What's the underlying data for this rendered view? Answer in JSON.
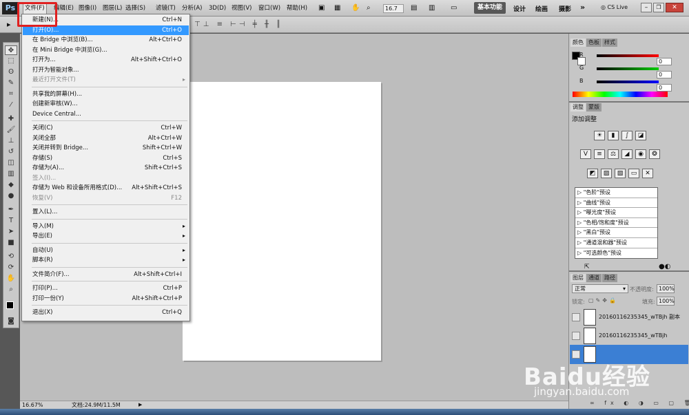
{
  "app": {
    "logo": "Ps"
  },
  "menubar": {
    "items": [
      "文件(F)",
      "编辑(E)",
      "图像(I)",
      "图层(L)",
      "选择(S)",
      "滤镜(T)",
      "分析(A)",
      "3D(D)",
      "视图(V)",
      "窗口(W)",
      "帮助(H)"
    ],
    "zoom": "16.7",
    "workspaces": [
      "基本功能",
      "设计",
      "绘画",
      "摄影"
    ],
    "more": "»",
    "cslive": "CS Live"
  },
  "file_menu": [
    {
      "label": "新建(N)...",
      "shortcut": "Ctrl+N"
    },
    {
      "label": "打开(O)...",
      "shortcut": "Ctrl+O",
      "highlighted": true
    },
    {
      "label": "在 Bridge 中浏览(B)...",
      "shortcut": "Alt+Ctrl+O"
    },
    {
      "label": "在 Mini Bridge 中浏览(G)...",
      "shortcut": ""
    },
    {
      "label": "打开为...",
      "shortcut": "Alt+Shift+Ctrl+O"
    },
    {
      "label": "打开为智能对象...",
      "shortcut": ""
    },
    {
      "label": "最近打开文件(T)",
      "shortcut": "",
      "submenu": true,
      "disabled": true
    },
    {
      "sep": true
    },
    {
      "label": "共享我的屏幕(H)...",
      "shortcut": ""
    },
    {
      "label": "创建新审核(W)...",
      "shortcut": ""
    },
    {
      "label": "Device Central...",
      "shortcut": ""
    },
    {
      "sep": true
    },
    {
      "label": "关闭(C)",
      "shortcut": "Ctrl+W"
    },
    {
      "label": "关闭全部",
      "shortcut": "Alt+Ctrl+W"
    },
    {
      "label": "关闭并转到 Bridge...",
      "shortcut": "Shift+Ctrl+W"
    },
    {
      "label": "存储(S)",
      "shortcut": "Ctrl+S"
    },
    {
      "label": "存储为(A)...",
      "shortcut": "Shift+Ctrl+S"
    },
    {
      "label": "签入(I)...",
      "shortcut": "",
      "disabled": true
    },
    {
      "label": "存储为 Web 和设备所用格式(D)...",
      "shortcut": "Alt+Shift+Ctrl+S"
    },
    {
      "label": "恢复(V)",
      "shortcut": "F12",
      "disabled": true
    },
    {
      "sep": true
    },
    {
      "label": "置入(L)...",
      "shortcut": ""
    },
    {
      "sep": true
    },
    {
      "label": "导入(M)",
      "shortcut": "",
      "submenu": true
    },
    {
      "label": "导出(E)",
      "shortcut": "",
      "submenu": true
    },
    {
      "sep": true
    },
    {
      "label": "自动(U)",
      "shortcut": "",
      "submenu": true
    },
    {
      "label": "脚本(R)",
      "shortcut": "",
      "submenu": true
    },
    {
      "sep": true
    },
    {
      "label": "文件简介(F)...",
      "shortcut": "Alt+Shift+Ctrl+I"
    },
    {
      "sep": true
    },
    {
      "label": "打印(P)...",
      "shortcut": "Ctrl+P"
    },
    {
      "label": "打印一份(Y)",
      "shortcut": "Alt+Shift+Ctrl+P"
    },
    {
      "sep": true
    },
    {
      "label": "退出(X)",
      "shortcut": "Ctrl+Q"
    }
  ],
  "color_panel": {
    "tabs": [
      "颜色",
      "色板",
      "样式"
    ],
    "channels": [
      {
        "name": "R",
        "value": "0"
      },
      {
        "name": "G",
        "value": "0"
      },
      {
        "name": "B",
        "value": "0"
      }
    ]
  },
  "adjustments_panel": {
    "tabs": [
      "调整",
      "蒙版"
    ],
    "title": "添加调整",
    "presets": [
      "\"色阶\"预设",
      "\"曲线\"预设",
      "\"曝光度\"预设",
      "\"色相/饱和度\"预设",
      "\"黑白\"预设",
      "\"通道混和器\"预设",
      "\"可选颜色\"预设"
    ]
  },
  "layers_panel": {
    "tabs": [
      "图层",
      "通道",
      "路径"
    ],
    "blend_mode": "正常",
    "opacity_label": "不透明度:",
    "opacity": "100%",
    "lock_label": "锁定:",
    "fill_label": "填充:",
    "fill": "100%",
    "layers": [
      "20160116235345_wTBjh 副本",
      "20160116235345_wTBjh",
      ""
    ]
  },
  "status": {
    "zoom": "16.67%",
    "doc": "文档:24.9M/11.5M"
  },
  "watermark": {
    "main": "Baidu经验",
    "url": "jingyan.baidu.com"
  }
}
